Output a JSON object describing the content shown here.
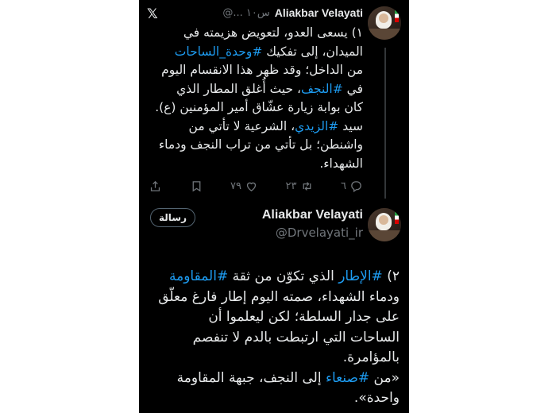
{
  "tweet1": {
    "display_name": "Aliakbar Velayati",
    "meta": "@... ۱۰س",
    "lines": [
      [
        "۱) يسعى العدو، لتعويض هزيمته في"
      ],
      [
        "الميدان، إلى تفكيك ",
        {
          "tag": "#وحدة_الساحات"
        }
      ],
      [
        "من الداخل؛ وقد ظهر هذا الانقسام اليوم"
      ],
      [
        "في ",
        {
          "tag": "#النجف"
        },
        "، حيث أُغلق المطار الذي"
      ],
      [
        "كان بوابة زيارة عشّاق أمير المؤمنين (ع)."
      ],
      [
        "سيد ",
        {
          "tag": "#الزيدي"
        },
        "، الشرعية لا تأتي من"
      ],
      [
        "واشنطن؛ بل تأتي من تراب النجف ودماء"
      ],
      [
        "الشهداء."
      ]
    ],
    "actions": {
      "reply_count": "٦",
      "retweet_count": "٢٣",
      "like_count": "٧٩"
    }
  },
  "tweet2": {
    "display_name": "Aliakbar Velayati",
    "handle": "@Drvelayati_ir",
    "message_button": "رسالة",
    "lines": [
      [
        "۲) ",
        {
          "tag": "#الإطار"
        },
        " الذي تكوّن من ثقة ",
        {
          "tag": "#المقاومة"
        }
      ],
      [
        "ودماء الشهداء، صمته اليوم إطار فارغ معلّق"
      ],
      [
        "على جدار السلطة؛ لكن ليعلموا أن"
      ],
      [
        "الساحات التي ارتبطت بالدم لا تنفصم"
      ],
      [
        "بالمؤامرة."
      ],
      [
        "«من ",
        {
          "tag": "#صنعاء"
        },
        " إلى النجف، جبهة المقاومة"
      ],
      [
        "واحدة»."
      ]
    ]
  },
  "colors": {
    "background": "#000000",
    "text": "#e7e9ea",
    "secondary": "#71767b",
    "link": "#1d9bf0"
  }
}
